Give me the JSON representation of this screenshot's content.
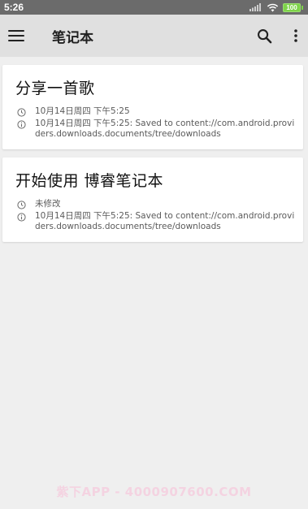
{
  "status_bar": {
    "time": "5:26",
    "battery": "100",
    "icons": [
      "signal-icon",
      "wifi-icon",
      "battery-icon"
    ]
  },
  "toolbar": {
    "title": "笔记本",
    "icons": [
      "menu-icon",
      "search-icon",
      "more-vert-icon"
    ]
  },
  "notes": [
    {
      "title": "分享一首歌",
      "modified": "10月14日周四 下午5:25",
      "info": "10月14日周四 下午5:25: Saved to content://com.android.providers.downloads.documents/tree/downloads"
    },
    {
      "title": "开始使用 博睿笔记本",
      "modified": "未修改",
      "info": "10月14日周四 下午5:25: Saved to content://com.android.providers.downloads.documents/tree/downloads"
    }
  ],
  "watermark": "紫下APP - 4000907600.COM",
  "colors": {
    "status_bar": "#6b6b6b",
    "toolbar": "#e0e0e0",
    "background": "#efefef",
    "card": "#ffffff",
    "battery": "#7ed34a"
  }
}
